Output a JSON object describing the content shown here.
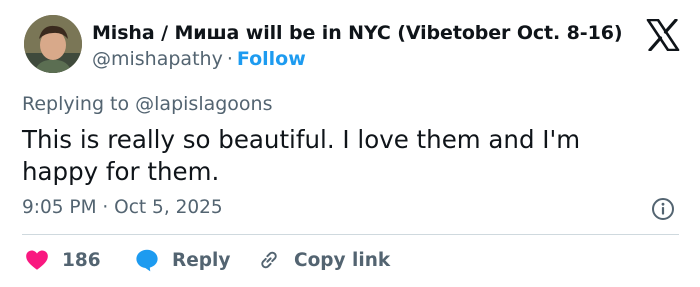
{
  "author": {
    "display_name": "Misha / Миша will be in NYC (Vibetober Oct. 8-16)",
    "handle": "@mishapathy",
    "separator": "·",
    "follow_label": "Follow"
  },
  "tweet": {
    "replying_to": "Replying to @lapislagoons",
    "text": "This is really so beautiful. I love them and I'm happy for them.",
    "timestamp": "9:05 PM · Oct 5, 2025"
  },
  "actions": {
    "like_count": "186",
    "reply_label": "Reply",
    "copy_link_label": "Copy link"
  },
  "icons": {
    "brand": "x-logo",
    "info": "info-icon",
    "like": "heart-icon",
    "reply": "speech-bubble-icon",
    "copy": "link-icon"
  },
  "colors": {
    "link_blue": "#1d9bf0",
    "heart_pink": "#f91880",
    "secondary_text": "#536471",
    "divider": "#cfd9de"
  }
}
